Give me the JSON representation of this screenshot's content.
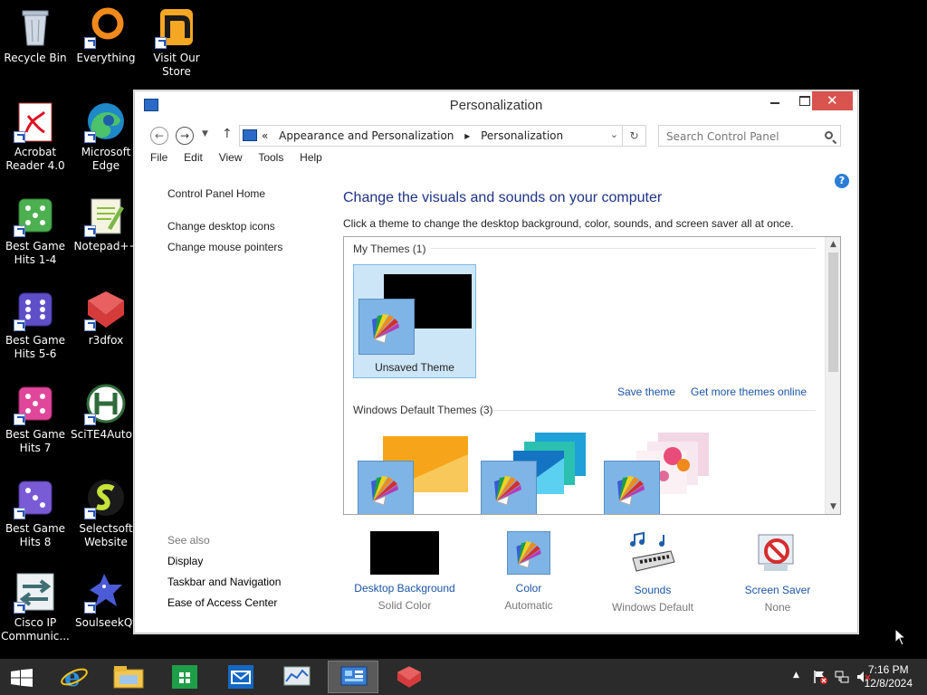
{
  "desktop": {
    "icons": [
      {
        "label": "Recycle Bin"
      },
      {
        "label": "Everything"
      },
      {
        "label": "Visit Our Store"
      },
      {
        "label": "Acrobat Reader 4.0"
      },
      {
        "label": "Microsoft Edge"
      },
      {
        "label": "Best Game Hits 1-4"
      },
      {
        "label": "Notepad++"
      },
      {
        "label": "Best Game Hits 5-6"
      },
      {
        "label": "r3dfox"
      },
      {
        "label": "Best Game Hits 7"
      },
      {
        "label": "SciTE4Auto..."
      },
      {
        "label": "Best Game Hits 8"
      },
      {
        "label": "Selectsoft Website"
      },
      {
        "label": "Cisco IP Communic..."
      },
      {
        "label": "SoulseekQt"
      }
    ]
  },
  "window": {
    "title": "Personalization",
    "close_glyph": "✕",
    "address": {
      "prefix": "«",
      "crumbs": [
        "Appearance and Personalization",
        "Personalization"
      ],
      "separator": "▸"
    },
    "search_placeholder": "Search Control Panel",
    "menu": [
      "File",
      "Edit",
      "View",
      "Tools",
      "Help"
    ],
    "help_glyph": "?"
  },
  "leftnav": {
    "home": "Control Panel Home",
    "links": [
      "Change desktop icons",
      "Change mouse pointers"
    ],
    "see_also_header": "See also",
    "see_also": [
      "Display",
      "Taskbar and Navigation",
      "Ease of Access Center"
    ]
  },
  "main": {
    "heading": "Change the visuals and sounds on your computer",
    "subheading": "Click a theme to change the desktop background, color, sounds, and screen saver all at once.",
    "my_themes_label": "My Themes (1)",
    "unsaved_theme_label": "Unsaved Theme",
    "save_theme": "Save theme",
    "get_more_themes": "Get more themes online",
    "default_themes_label": "Windows Default Themes (3)"
  },
  "bottom": {
    "items": [
      {
        "title": "Desktop Background",
        "value": "Solid Color"
      },
      {
        "title": "Color",
        "value": "Automatic"
      },
      {
        "title": "Sounds",
        "value": "Windows Default"
      },
      {
        "title": "Screen Saver",
        "value": "None"
      }
    ]
  },
  "taskbar": {
    "time": "7:16 PM",
    "date": "12/8/2024"
  },
  "colors": {
    "accent": "#1e3287",
    "link": "#1b54a8",
    "selection": "#cde6f7",
    "close": "#d9534f"
  }
}
